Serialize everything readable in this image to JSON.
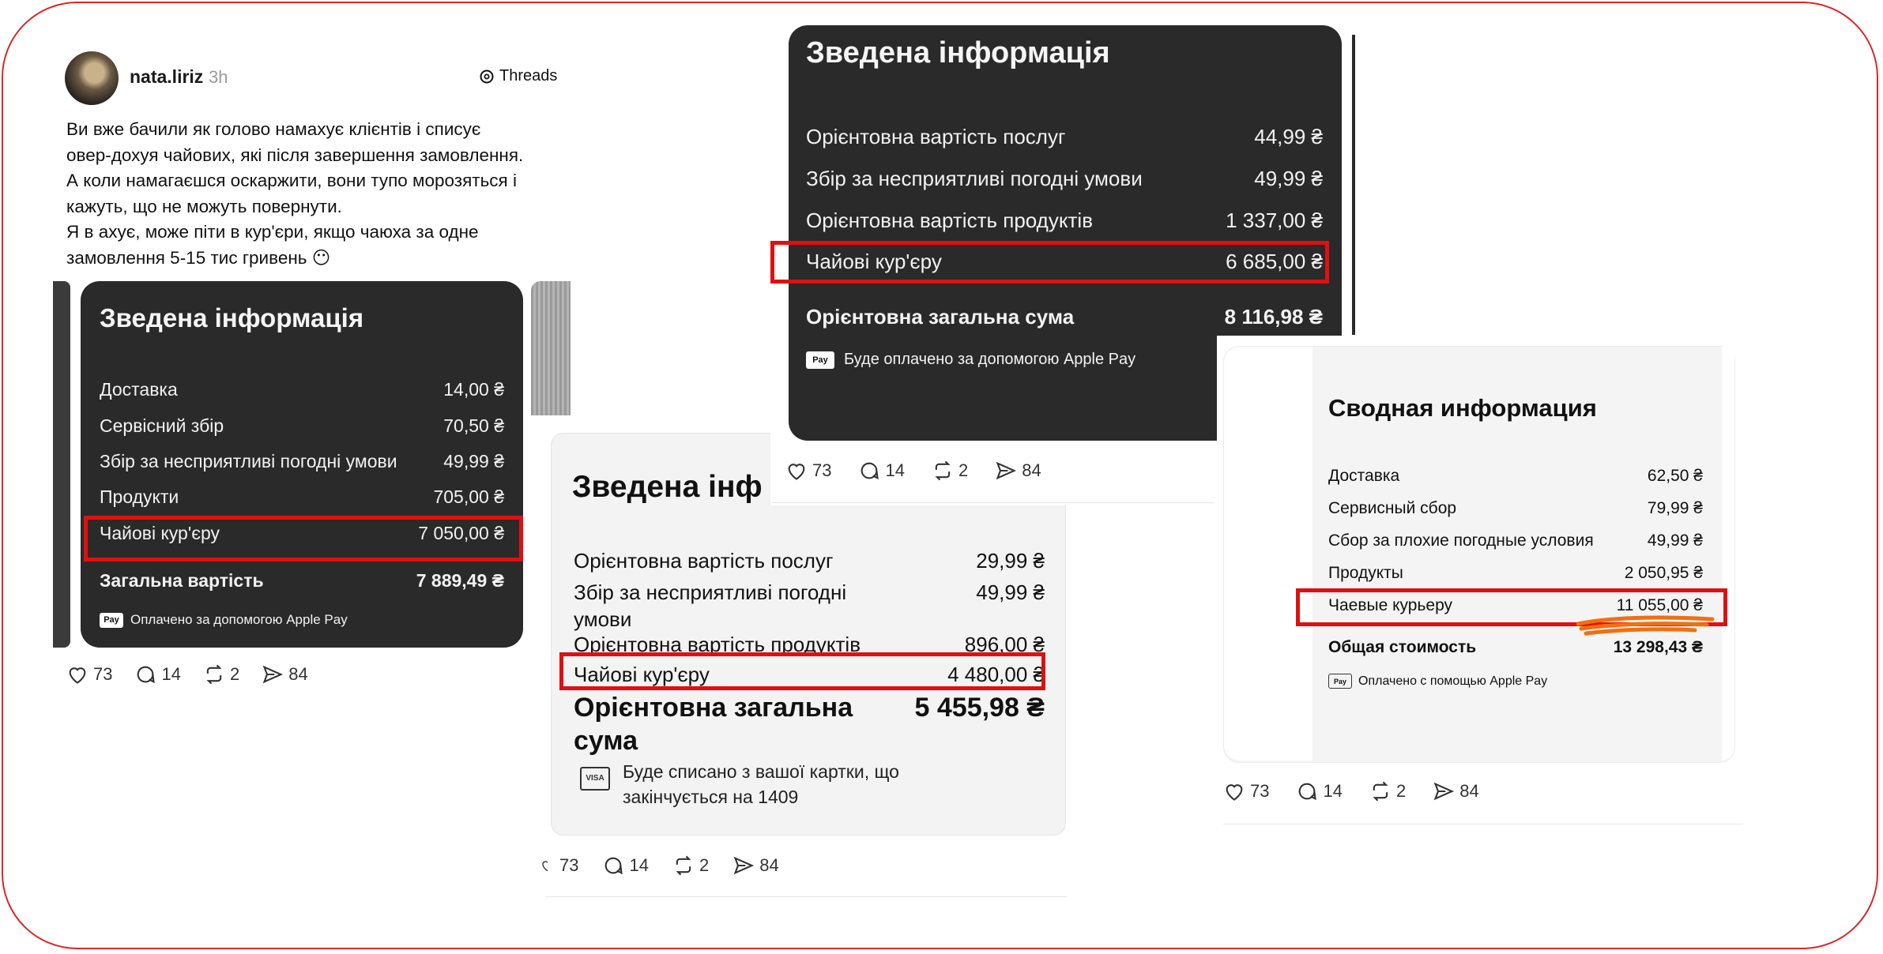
{
  "post": {
    "username": "nata.liriz",
    "time": "3h",
    "platform": "Threads",
    "text_lines": [
      "Ви вже бачили як голово намахує клієнтів і списує",
      "овер-дохуя чайових, які після завершення замовлення.",
      "А коли намагаєшся оскаржити, вони тупо морозяться і",
      "кажуть, що не можуть повернути.",
      "Я в ахує, може піти в кур'єри, якщо чаюха за одне",
      "замовлення 5-15 тис гривень 😶"
    ]
  },
  "card1": {
    "title": "Зведена інформація",
    "rows": [
      {
        "label": "Доставка",
        "value": "14,00 ₴"
      },
      {
        "label": "Сервісний збір",
        "value": "70,50 ₴"
      },
      {
        "label": "Збір за несприятливі погодні умови",
        "value": "49,99 ₴"
      },
      {
        "label": "Продукти",
        "value": "705,00 ₴"
      },
      {
        "label": "Чайові кур'єру",
        "value": "7 050,00 ₴"
      }
    ],
    "total_label": "Загальна вартість",
    "total_value": "7 889,49 ₴",
    "payment": "Оплачено за допомогою Apple Pay",
    "pay_badge": "Pay"
  },
  "card2": {
    "title": "Зведена інформація",
    "rows": [
      {
        "label": "Орієнтовна вартість послуг",
        "value": "44,99 ₴"
      },
      {
        "label": "Збір за несприятливі погодні умови",
        "value": "49,99 ₴"
      },
      {
        "label": "Орієнтовна вартість продуктів",
        "value": "1 337,00 ₴"
      },
      {
        "label": "Чайові кур'єру",
        "value": "6 685,00 ₴"
      }
    ],
    "total_label": "Орієнтовна загальна сума",
    "total_value": "8 116,98 ₴",
    "payment": "Буде оплачено за допомогою Apple Pay",
    "pay_badge": "Pay"
  },
  "card3": {
    "title": "Зведена інф",
    "rows": [
      {
        "label": "Орієнтовна вартість послуг",
        "value": "29,99 ₴"
      },
      {
        "label": "Збір за несприятливі погодні",
        "label2": "умови",
        "value": "49,99 ₴"
      },
      {
        "label": "Орієнтовна вартість продуктів",
        "value": "896,00 ₴"
      },
      {
        "label": "Чайові кур'єру",
        "value": "4 480,00 ₴"
      }
    ],
    "total_label": "Орієнтовна загальна",
    "total_label2": "сума",
    "total_value": "5 455,98 ₴",
    "payment_line1": "Буде списано з вашої картки, що",
    "payment_line2": "закінчується на 1409",
    "card_badge": "VISA"
  },
  "card4": {
    "title": "Сводная информация",
    "rows": [
      {
        "label": "Доставка",
        "value": "62,50 ₴"
      },
      {
        "label": "Сервисный сбор",
        "value": "79,99 ₴"
      },
      {
        "label": "Сбор за плохие погодные условия",
        "value": "49,99 ₴"
      },
      {
        "label": "Продукты",
        "value": "2 050,95 ₴"
      },
      {
        "label": "Чаевые курьеру",
        "value": "11 055,00 ₴"
      }
    ],
    "total_label": "Общая стоимость",
    "total_value": "13 298,43 ₴",
    "payment": "Оплачено с помощью Apple Pay",
    "pay_badge": "Pay"
  },
  "stats": {
    "likes": "73",
    "comments": "14",
    "reposts": "2",
    "shares": "84"
  },
  "colors": {
    "highlight": "#e01010",
    "dark_card": "#2a2a2a",
    "frame": "#d42a2a",
    "scribble": "#f07010"
  }
}
